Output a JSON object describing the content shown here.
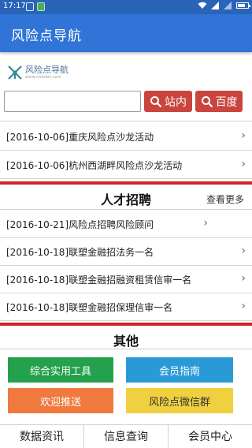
{
  "statusbar": {
    "time": "17:17",
    "wifi_icon": "wifi-icon",
    "signal_icon": "signal-icon",
    "battery_icon": "battery-icon"
  },
  "appbar": {
    "title": "风险点导航"
  },
  "logo": {
    "name": "风险点导航",
    "url": "www.riskdot.com"
  },
  "search": {
    "value": "",
    "site_button": "站内",
    "baidu_button": "百度",
    "button_color": "#c9453d"
  },
  "events": [
    {
      "text": "[2016-10-06]重庆风险点沙龙活动"
    },
    {
      "text": "[2016-10-06]杭州西湖畔风险点沙龙活动"
    }
  ],
  "recruit": {
    "title": "人才招聘",
    "more": "查看更多",
    "items": [
      {
        "text": "[2016-10-21]风险点招聘风险顾问"
      },
      {
        "text": "[2016-10-18]联塑金融招法务一名"
      },
      {
        "text": "[2016-10-18]联塑金融招融资租赁信审一名"
      },
      {
        "text": "[2016-10-18]联塑金融招保理信审一名"
      }
    ]
  },
  "other": {
    "title": "其他",
    "tiles": [
      {
        "label": "综合实用工具",
        "color": "#24a14c"
      },
      {
        "label": "会员指南",
        "color": "#2a9ad7"
      },
      {
        "label": "欢迎推送",
        "color": "#f07a3e"
      },
      {
        "label": "风险点微信群",
        "color": "#f0d03e"
      }
    ]
  },
  "bottom_nav": [
    {
      "label": "数据资讯"
    },
    {
      "label": "信息查询"
    },
    {
      "label": "会员中心"
    }
  ],
  "colors": {
    "appbar": "#2f74d6",
    "statusbar": "#2a64b9",
    "divider": "#d1232a"
  }
}
